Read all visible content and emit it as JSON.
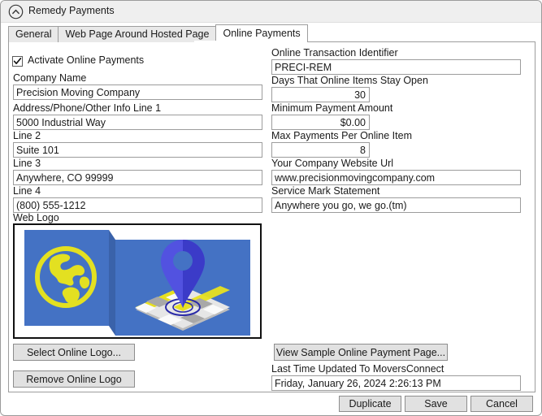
{
  "window": {
    "title": "Remedy Payments",
    "collapse_icon": "chevron-up-circle-icon"
  },
  "tabs": [
    {
      "label": "General",
      "active": false
    },
    {
      "label": "Web Page Around Hosted Page",
      "active": false
    },
    {
      "label": "Online Payments",
      "active": true
    }
  ],
  "left_column": {
    "activate_checkbox": {
      "label": "Activate Online Payments",
      "checked": true
    },
    "fields": [
      {
        "label": "Company Name",
        "value": "Precision Moving Company"
      },
      {
        "label": "Address/Phone/Other Info Line 1",
        "value": "5000 Industrial Way"
      },
      {
        "label": "Line 2",
        "value": "Suite 101"
      },
      {
        "label": "Line 3",
        "value": "Anywhere, CO 99999"
      },
      {
        "label": "Line 4",
        "value": "(800) 555-1212"
      }
    ],
    "web_logo_label": "Web Logo",
    "select_logo_button": "Select Online Logo...",
    "remove_logo_button": "Remove Online Logo"
  },
  "right_column": {
    "fields": [
      {
        "label": "Online Transaction Identifier",
        "value": "PRECI-REM",
        "align": "left"
      },
      {
        "label": "Days That Online Items Stay Open",
        "value": "30",
        "align": "right"
      },
      {
        "label": "Minimum Payment Amount",
        "value": "$0.00",
        "align": "right"
      },
      {
        "label": "Max Payments Per Online Item",
        "value": "8",
        "align": "right"
      },
      {
        "label": "Your Company Website Url",
        "value": "www.precisionmovingcompany.com",
        "align": "left"
      },
      {
        "label": "Service Mark Statement",
        "value": "Anywhere you go, we go.(tm)",
        "align": "left"
      }
    ],
    "view_sample_button": "View Sample Online Payment Page...",
    "last_updated_label": "Last Time Updated To MoversConnect",
    "last_updated_value": "Friday, January 26, 2024 2:26:13 PM"
  },
  "footer": {
    "duplicate_button": "Duplicate",
    "save_button": "Save",
    "cancel_button": "Cancel"
  },
  "logo": {
    "alt": "Precision Moving Company web logo: yellow globe and blue map pin on map",
    "colors": {
      "panel_blue": "#4472C4",
      "panel_blue_dark": "#3A62AA",
      "globe_yellow": "#E3E021",
      "pin_blue": "#4040D0",
      "pin_blue_dark": "#3434B4",
      "map_road_yellow": "#E8E020",
      "map_gray": "#9E9E9E",
      "map_white": "#F2F2F2"
    }
  },
  "theme": {
    "titlebar_bg": "#EFEFEF",
    "panel_bg": "#FFFFFF",
    "button_bg": "#E1E1E1",
    "border": "#9C9C9C",
    "text": "#1A1A1A"
  }
}
